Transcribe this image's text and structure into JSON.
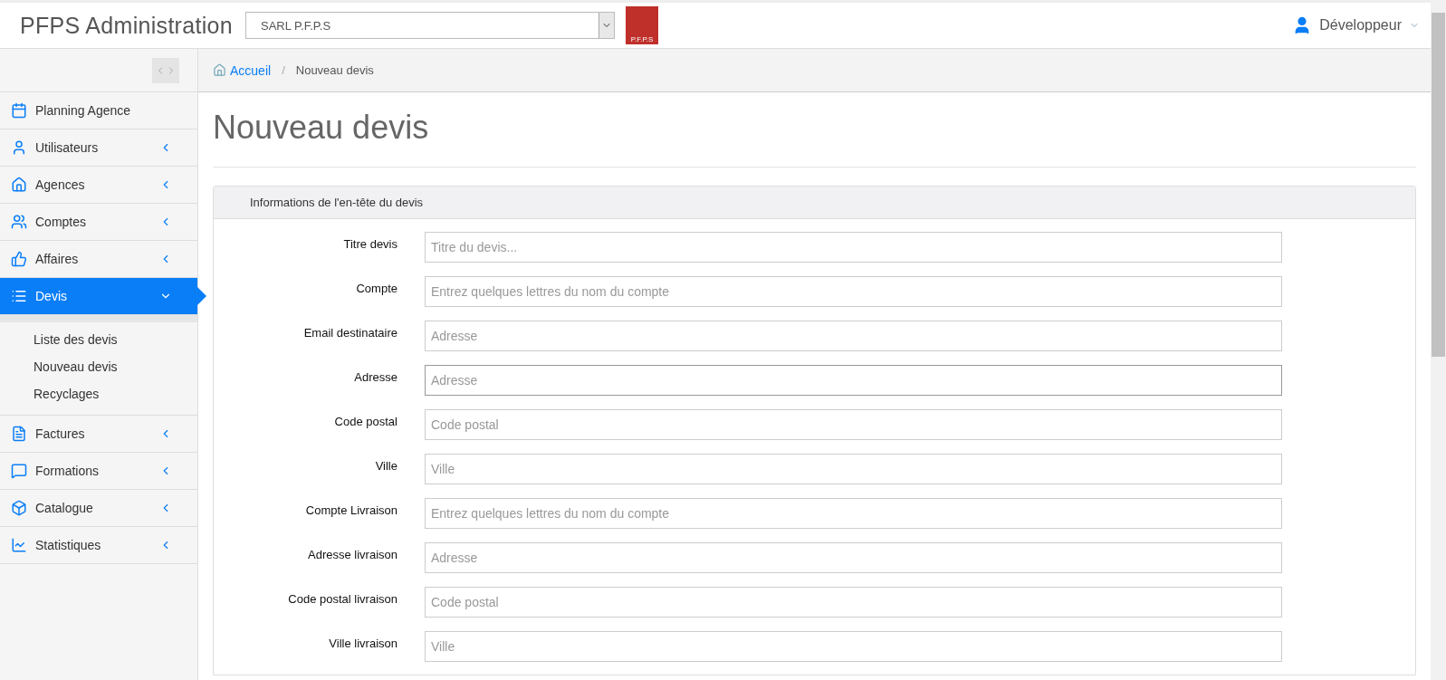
{
  "header": {
    "title": "PFPS Administration",
    "company_select": {
      "value": "SARL P.F.P.S"
    },
    "logo_text": "P.F.P.S",
    "user": "Développeur"
  },
  "breadcrumb": [
    {
      "label": "Accueil",
      "kind": "link"
    },
    {
      "label": "/",
      "kind": "separator"
    },
    {
      "label": "Nouveau devis",
      "kind": "current"
    }
  ],
  "sidebar": {
    "items": [
      {
        "label": "Planning Agence",
        "kind": "link",
        "selected": false
      },
      {
        "label": "Utilisateurs",
        "kind": "group",
        "selected": false,
        "expanded": false
      },
      {
        "label": "Agences",
        "kind": "group",
        "selected": false,
        "expanded": false
      },
      {
        "label": "Comptes",
        "kind": "group",
        "selected": false,
        "expanded": false
      },
      {
        "label": "Affaires",
        "kind": "group",
        "selected": false,
        "expanded": false
      },
      {
        "label": "Devis",
        "kind": "group",
        "selected": true,
        "expanded": true,
        "children": [
          {
            "label": "Liste des devis"
          },
          {
            "label": "Nouveau devis"
          },
          {
            "label": "Recyclages"
          }
        ]
      },
      {
        "label": "Factures",
        "kind": "group",
        "selected": false,
        "expanded": false
      },
      {
        "label": "Formations",
        "kind": "group",
        "selected": false,
        "expanded": false
      },
      {
        "label": "Catalogue",
        "kind": "group",
        "selected": false,
        "expanded": false
      },
      {
        "label": "Statistiques",
        "kind": "group",
        "selected": false,
        "expanded": false
      }
    ]
  },
  "page_title": "Nouveau devis",
  "panel": {
    "title": "Informations de l'en-tête du devis",
    "fields": [
      {
        "label": "Titre devis",
        "placeholder": "Titre du devis...",
        "focused": false
      },
      {
        "label": "Compte",
        "placeholder": "Entrez quelques lettres du nom du compte",
        "focused": false
      },
      {
        "label": "Email destinataire",
        "placeholder": "Adresse",
        "focused": false
      },
      {
        "label": "Adresse",
        "placeholder": "Adresse",
        "focused": true
      },
      {
        "label": "Code postal",
        "placeholder": "Code postal",
        "focused": false
      },
      {
        "label": "Ville",
        "placeholder": "Ville",
        "focused": false
      },
      {
        "label": "Compte Livraison",
        "placeholder": "Entrez quelques lettres du nom du compte",
        "focused": false
      },
      {
        "label": "Adresse livraison",
        "placeholder": "Adresse",
        "focused": false
      },
      {
        "label": "Code postal livraison",
        "placeholder": "Code postal",
        "focused": false
      },
      {
        "label": "Ville livraison",
        "placeholder": "Ville",
        "focused": false
      }
    ]
  }
}
